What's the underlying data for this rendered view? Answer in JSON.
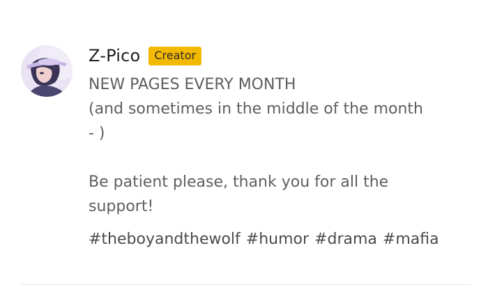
{
  "post": {
    "author": {
      "name": "Z-Pico",
      "badge": "Creator",
      "avatar_icon": "avatar-icon"
    },
    "lines": [
      "NEW PAGES EVERY MONTH",
      "(and sometimes in the middle of the month",
      "- )",
      "",
      "Be patient please, thank you for all the",
      "support!"
    ],
    "tags": [
      "#theboyandthewolf",
      "#humor",
      "#drama",
      "#mafia"
    ]
  },
  "colors": {
    "badge": "#f3b800",
    "text": "#5e5e5e",
    "name": "#1f1f1f"
  }
}
